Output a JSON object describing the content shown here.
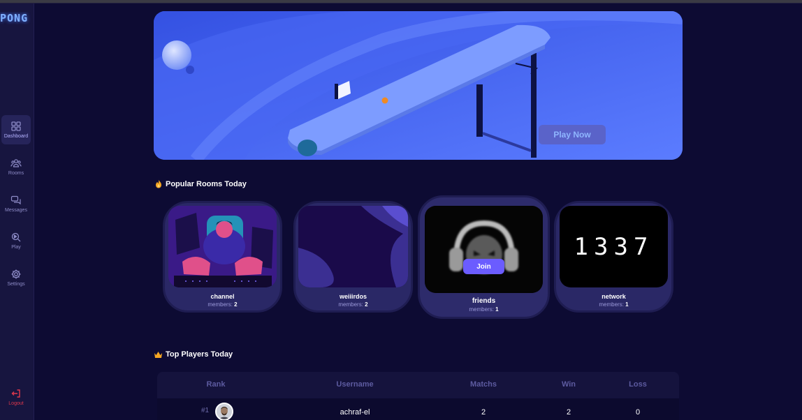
{
  "app": {
    "logo": "PONG"
  },
  "sidebar": {
    "items": [
      {
        "label": "Dashboard",
        "icon": "grid-icon",
        "active": true
      },
      {
        "label": "Rooms",
        "icon": "users-icon"
      },
      {
        "label": "Messages",
        "icon": "messages-icon"
      },
      {
        "label": "Play",
        "icon": "play-search-icon"
      },
      {
        "label": "Settings",
        "icon": "gear-icon"
      }
    ],
    "logout": {
      "label": "Logout",
      "icon": "logout-icon"
    }
  },
  "hero": {
    "button_label": "Play Now"
  },
  "popular": {
    "title": "Popular Rooms Today",
    "icon": "fire-icon",
    "members_label": "members:",
    "join_label": "Join",
    "rooms": [
      {
        "name": "channel",
        "members": "2"
      },
      {
        "name": "weiiirdos",
        "members": "2"
      },
      {
        "name": "friends",
        "members": "1"
      },
      {
        "name": "network",
        "members": "1",
        "image_text": "1337"
      }
    ]
  },
  "top_players": {
    "title": "Top Players Today",
    "icon": "crown-icon",
    "columns": [
      "Rank",
      "Username",
      "Matchs",
      "Win",
      "Loss"
    ],
    "rows": [
      {
        "rank": "#1",
        "username": "achraf-el",
        "matchs": "2",
        "win": "2",
        "loss": "0"
      }
    ]
  },
  "colors": {
    "background": "#0d0b33",
    "sidebar": "#17153f",
    "accent": "#6b5cff",
    "logout": "#e0384c"
  }
}
